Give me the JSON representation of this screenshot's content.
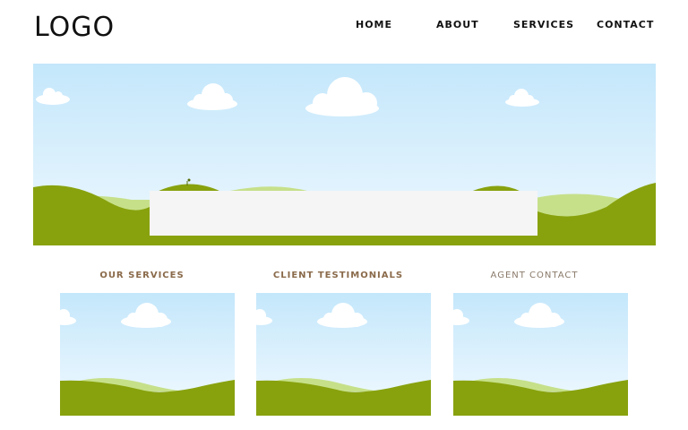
{
  "header": {
    "logo": "LOGO",
    "nav": [
      {
        "label": "HOME"
      },
      {
        "label": "ABOUT"
      },
      {
        "label": "SERVICES"
      },
      {
        "label": "CONTACT"
      }
    ]
  },
  "hero": {
    "image": "landscape-placeholder"
  },
  "columns": [
    {
      "title": "OUR SERVICES",
      "image": "landscape-placeholder"
    },
    {
      "title": "CLIENT TESTIMONIALS",
      "image": "landscape-placeholder"
    },
    {
      "title": "AGENT CONTACT",
      "image": "landscape-placeholder"
    }
  ],
  "colors": {
    "sky_top": "#c4e7fb",
    "sky_bottom": "#eef8fe",
    "hill_dark": "#88a20e",
    "hill_light": "#c6e08a",
    "cloud": "#ffffff",
    "heading_brown": "#8a6a4a"
  }
}
